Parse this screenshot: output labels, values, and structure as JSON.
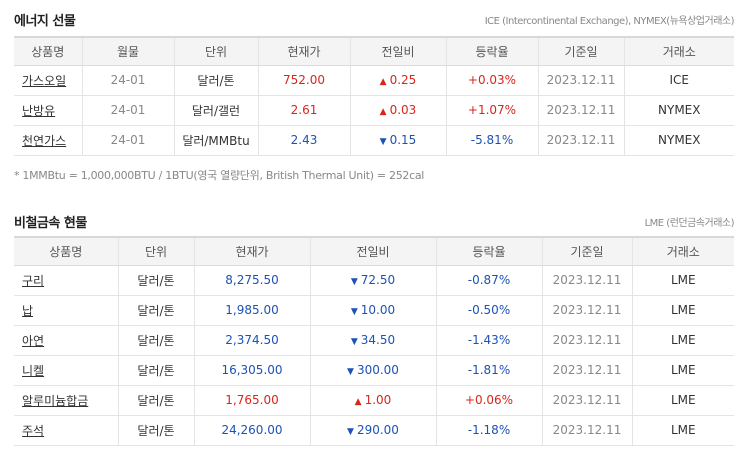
{
  "energy": {
    "title": "에너지 선물",
    "source": "ICE (Intercontinental Exchange), NYMEX(뉴욕상업거래소)",
    "headers": [
      "상품명",
      "월물",
      "단위",
      "현재가",
      "전일비",
      "등락율",
      "기준일",
      "거래소"
    ],
    "rows": [
      {
        "name": "가스오일",
        "month": "24-01",
        "unit": "달러/톤",
        "price": "752.00",
        "dir": "up",
        "change": "0.25",
        "rate": "+0.03%",
        "date": "2023.12.11",
        "exchange": "ICE"
      },
      {
        "name": "난방유",
        "month": "24-01",
        "unit": "달러/갤런",
        "price": "2.61",
        "dir": "up",
        "change": "0.03",
        "rate": "+1.07%",
        "date": "2023.12.11",
        "exchange": "NYMEX"
      },
      {
        "name": "천연가스",
        "month": "24-01",
        "unit": "달러/MMBtu",
        "price": "2.43",
        "dir": "down",
        "change": "0.15",
        "rate": "-5.81%",
        "date": "2023.12.11",
        "exchange": "NYMEX"
      }
    ],
    "note": "* 1MMBtu = 1,000,000BTU / 1BTU(영국 열량단위, British Thermal Unit) = 252cal"
  },
  "metals": {
    "title": "비철금속 현물",
    "source": "LME (런던금속거래소)",
    "headers": [
      "상품명",
      "단위",
      "현재가",
      "전일비",
      "등락율",
      "기준일",
      "거래소"
    ],
    "rows": [
      {
        "name": "구리",
        "unit": "달러/톤",
        "price": "8,275.50",
        "dir": "down",
        "change": "72.50",
        "rate": "-0.87%",
        "date": "2023.12.11",
        "exchange": "LME"
      },
      {
        "name": "납",
        "unit": "달러/톤",
        "price": "1,985.00",
        "dir": "down",
        "change": "10.00",
        "rate": "-0.50%",
        "date": "2023.12.11",
        "exchange": "LME"
      },
      {
        "name": "아연",
        "unit": "달러/톤",
        "price": "2,374.50",
        "dir": "down",
        "change": "34.50",
        "rate": "-1.43%",
        "date": "2023.12.11",
        "exchange": "LME"
      },
      {
        "name": "니켈",
        "unit": "달러/톤",
        "price": "16,305.00",
        "dir": "down",
        "change": "300.00",
        "rate": "-1.81%",
        "date": "2023.12.11",
        "exchange": "LME"
      },
      {
        "name": "알루미늄합금",
        "unit": "달러/톤",
        "price": "1,765.00",
        "dir": "up",
        "change": "1.00",
        "rate": "+0.06%",
        "date": "2023.12.11",
        "exchange": "LME"
      },
      {
        "name": "주석",
        "unit": "달러/톤",
        "price": "24,260.00",
        "dir": "down",
        "change": "290.00",
        "rate": "-1.18%",
        "date": "2023.12.11",
        "exchange": "LME"
      }
    ]
  },
  "icons": {
    "up": "▲",
    "down": "▼"
  },
  "colors": {
    "up": "#d9261c",
    "down": "#1d52b5"
  }
}
